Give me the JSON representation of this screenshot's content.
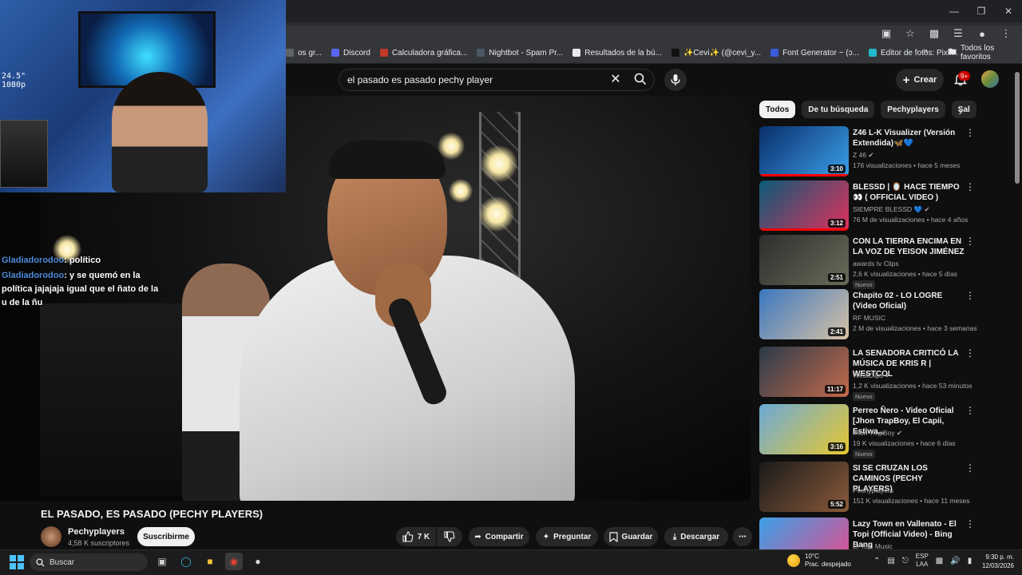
{
  "browser": {
    "bookmarks": [
      {
        "label": "os gr...",
        "color": "#5f6368"
      },
      {
        "label": "Discord",
        "color": "#5865f2"
      },
      {
        "label": "Calculadora gráfica...",
        "color": "#c0392b"
      },
      {
        "label": "Nightbot - Spam Pr...",
        "color": "#4a5868"
      },
      {
        "label": "Resultados de la bú...",
        "color": "#e8eaed"
      },
      {
        "label": "✨Cevi✨ (@cevi_y...",
        "color": "#111111"
      },
      {
        "label": "Font Generator ~ (ↄ...",
        "color": "#3b5bdb"
      },
      {
        "label": "Editor de fotos: Pixlr...",
        "color": "#21b8c9"
      }
    ],
    "all_bookmarks": "Todos los favoritos"
  },
  "header": {
    "search_query": "el pasado es pasado pechy player",
    "create_label": "Crear",
    "notif_count": "9+"
  },
  "overlay": {
    "cam_label": "24.5\"\n1080p",
    "chat": [
      {
        "user": "Gladiadorodoo",
        "msg": ": político"
      },
      {
        "user": "Gladiadorodoo",
        "msg": ": y se quemó en la política jajajaja igual que el ñato de la u de la ñu"
      }
    ]
  },
  "video": {
    "title": "EL PASADO, ES PASADO (PECHY PLAYERS)",
    "channel": "Pechyplayers",
    "subscribers": "4,58 K suscriptores",
    "subscribe_label": "Suscribirme",
    "likes": "7 K",
    "share_label": "Compartir",
    "ask_label": "Preguntar",
    "save_label": "Guardar",
    "download_label": "Descargar"
  },
  "chips": [
    "Todos",
    "De tu búsqueda",
    "Pechyplayers",
    "Sal"
  ],
  "recommendations": [
    {
      "title": "Z46 L-K Visualizer (Versión Extendida)🦋💙",
      "channel": "Z 46",
      "verified": true,
      "meta": "176 visualizaciones • hace 5 meses",
      "duration": "3:10",
      "is_new": false,
      "thumb": [
        "#0a2d6b",
        "#3aa0e8"
      ],
      "progress": 100
    },
    {
      "title": "BLESSD | 🪞 HACE TIEMPO 👀 ( OFFICIAL VIDEO )",
      "channel": "SIEMPRE BLESSD 💙",
      "verified": true,
      "meta": "76 M de visualizaciones • hace 4 años",
      "duration": "3:12",
      "is_new": false,
      "thumb": [
        "#0a5a7a",
        "#e0305a"
      ],
      "progress": 100
    },
    {
      "title": "CON LA TIERRA ENCIMA EN LA VOZ DE  YEISON JIMÉNEZ",
      "channel": "awards tv Clips",
      "verified": false,
      "meta": "2,6 K visualizaciones • hace 5 días",
      "duration": "2:51",
      "is_new": true,
      "thumb": [
        "#2d2d2d",
        "#6b6b5a"
      ],
      "progress": 0
    },
    {
      "title": "Chapito 02 - LO LOGRE (Video Oficial)",
      "channel": "RF MUSIC",
      "verified": false,
      "meta": "2 M de visualizaciones • hace 3 semanas",
      "duration": "2:41",
      "is_new": false,
      "thumb": [
        "#3a77c0",
        "#d8c2a5"
      ],
      "progress": 0
    },
    {
      "title": "LA SENADORA CRITICÓ LA MÚSICA DE KRIS R | WESTCOL",
      "channel": "WestClips",
      "verified": true,
      "meta": "1,2 K visualizaciones • hace 53 minutos",
      "duration": "11:17",
      "is_new": true,
      "thumb": [
        "#2a3a4a",
        "#c46a4a"
      ],
      "progress": 0
    },
    {
      "title": "Perreo Ñero - Video Oficial [Jhon TrapBoy, El Capii, Estiwa...",
      "channel": "Jhon TrapBoy",
      "verified": true,
      "meta": "19 K visualizaciones • hace 6 días",
      "duration": "3:16",
      "is_new": true,
      "thumb": [
        "#6aa9d8",
        "#e8c830"
      ],
      "progress": 0
    },
    {
      "title": "SI SE CRUZAN LOS CAMINOS (PECHY PLAYERS)",
      "channel": "Pechyplayers",
      "verified": false,
      "meta": "151 K visualizaciones • hace 11 meses",
      "duration": "5:52",
      "is_new": false,
      "thumb": [
        "#1a1a1a",
        "#8a5a3a"
      ],
      "progress": 0
    },
    {
      "title": "Lazy Town en Vallenato - El Topi (Official Video) - Bing Bang",
      "channel": "El Topi Music",
      "verified": false,
      "meta": "",
      "duration": "",
      "is_new": false,
      "thumb": [
        "#3aa0e8",
        "#e84a8a"
      ],
      "progress": 0
    }
  ],
  "taskbar": {
    "search_label": "Buscar",
    "weather_temp": "10°C",
    "weather_desc": "Prac. despejado",
    "lang_line1": "ESP",
    "lang_line2": "LAA",
    "time": "9:30 p. m.",
    "date": "12/03/2026"
  }
}
